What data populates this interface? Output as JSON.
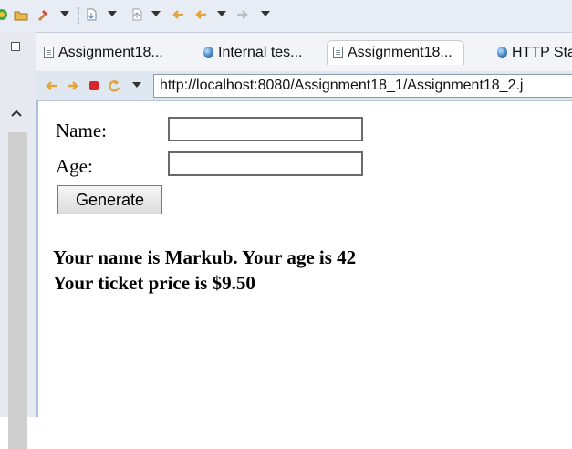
{
  "browser": {
    "tabs": [
      {
        "label": "Assignment18...",
        "icon": "page-icon",
        "active": false
      },
      {
        "label": "Internal tes...",
        "icon": "globe-icon",
        "active": false
      },
      {
        "label": "Assignment18...",
        "icon": "page-icon",
        "active": true
      },
      {
        "label": "HTTP Sta",
        "icon": "globe-icon",
        "active": false
      }
    ],
    "url": "http://localhost:8080/Assignment18_1/Assignment18_2.j"
  },
  "form": {
    "name_label": "Name:",
    "name_value": "",
    "age_label": "Age:",
    "age_value": "",
    "generate_label": "Generate"
  },
  "result": {
    "line1": "Your name is Markub. Your age is 42",
    "line2": "Your ticket price is $9.50"
  }
}
